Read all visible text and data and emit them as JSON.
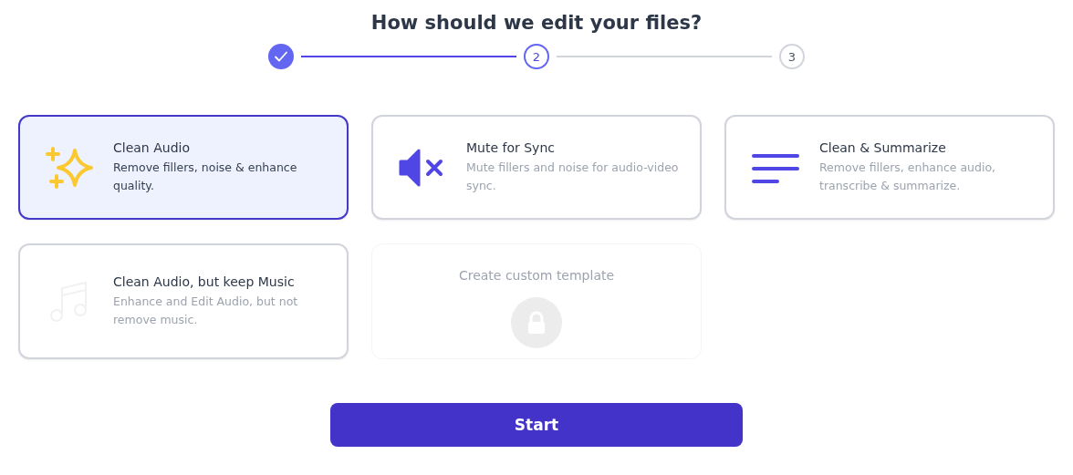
{
  "title": "How should we edit your files?",
  "steps": [
    {
      "completed": true,
      "selected": false
    },
    {
      "completed": false,
      "selected": true,
      "label": "2"
    },
    {
      "completed": false,
      "selected": false,
      "label": "3"
    }
  ],
  "cards": [
    {
      "kind": "template",
      "title": "Clean Audio",
      "description": "Remove fillers, noise & enhance quality.",
      "selected": true
    },
    {
      "kind": "template",
      "title": "Mute for Sync",
      "description": "Mute fillers and noise for audio-video sync.",
      "selected": false
    },
    {
      "kind": "template",
      "title": "Clean & Summarize",
      "description": "Remove fillers, enhance audio, transcribe & summarize.",
      "selected": false
    },
    {
      "kind": "template",
      "title": "Clean Audio, but keep Music",
      "description": "Enhance and Edit Audio, but not remove music.",
      "selected": false
    },
    {
      "kind": "locked",
      "title": "Create custom template"
    }
  ],
  "start_button": "Start"
}
